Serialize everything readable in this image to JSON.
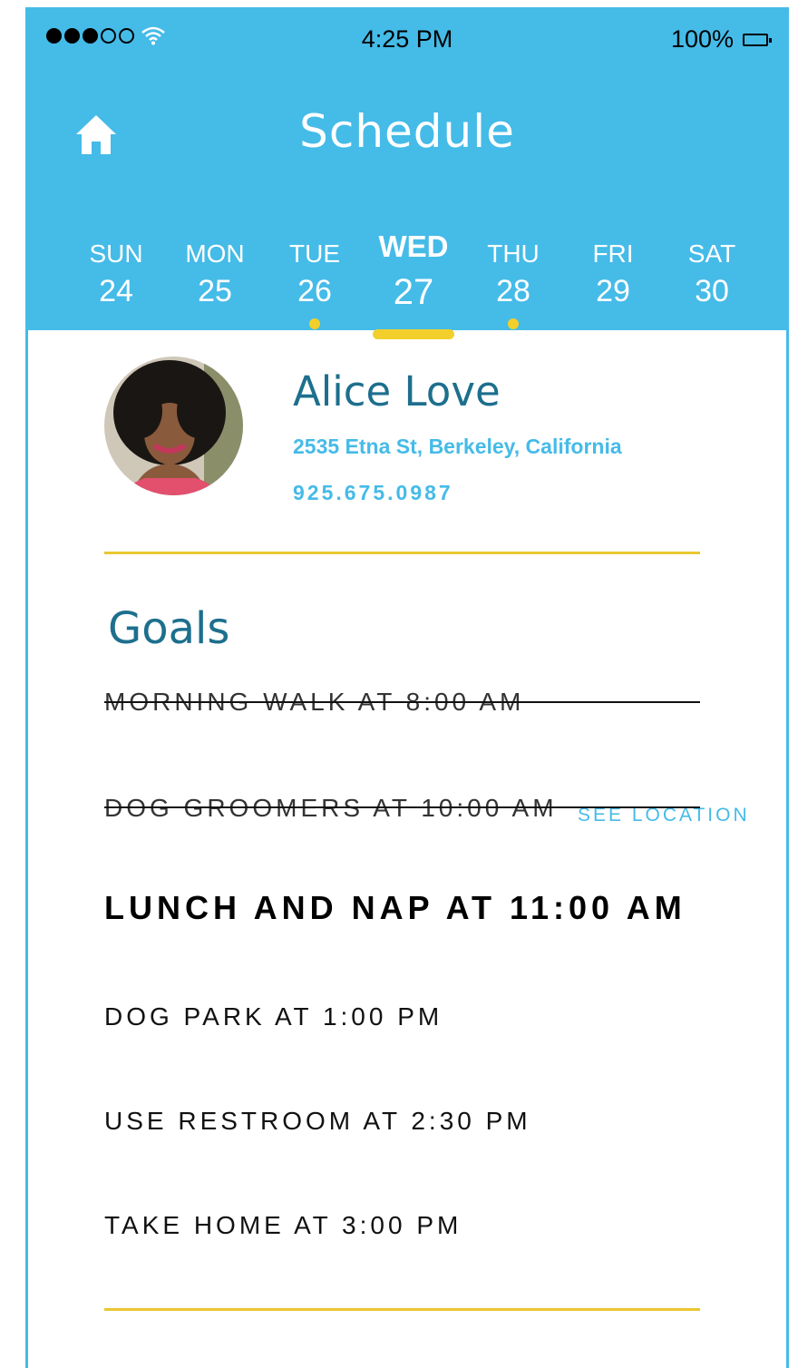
{
  "status_bar": {
    "time": "4:25 PM",
    "battery": "100%"
  },
  "header": {
    "title": "Schedule"
  },
  "week": {
    "days": [
      {
        "name": "SUN",
        "date": "24",
        "has_event": false,
        "selected": false
      },
      {
        "name": "MON",
        "date": "25",
        "has_event": false,
        "selected": false
      },
      {
        "name": "TUE",
        "date": "26",
        "has_event": true,
        "selected": false
      },
      {
        "name": "WED",
        "date": "27",
        "has_event": false,
        "selected": true
      },
      {
        "name": "THU",
        "date": "28",
        "has_event": true,
        "selected": false
      },
      {
        "name": "FRI",
        "date": "29",
        "has_event": false,
        "selected": false
      },
      {
        "name": "SAT",
        "date": "30",
        "has_event": false,
        "selected": false
      }
    ]
  },
  "profile": {
    "name": "Alice Love",
    "address": "2535 Etna St, Berkeley, California",
    "phone": "925.675.0987"
  },
  "goals": {
    "title": "Goals",
    "items": [
      {
        "text": "MORNING WALK AT 8:00 AM",
        "status": "done"
      },
      {
        "text": "DOG GROOMERS AT 10:00 AM",
        "status": "done",
        "link": "SEE LOCATION"
      },
      {
        "text": "LUNCH AND NAP AT 11:00 AM",
        "status": "current"
      },
      {
        "text": "DOG PARK AT 1:00 PM",
        "status": "upcoming"
      },
      {
        "text": "USE RESTROOM AT 2:30 PM",
        "status": "upcoming"
      },
      {
        "text": "TAKE HOME AT 3:00 PM",
        "status": "upcoming"
      }
    ]
  },
  "colors": {
    "header_blue": "#45bbe8",
    "accent_yellow": "#f2cf2a",
    "title_teal": "#1d6f8d"
  }
}
